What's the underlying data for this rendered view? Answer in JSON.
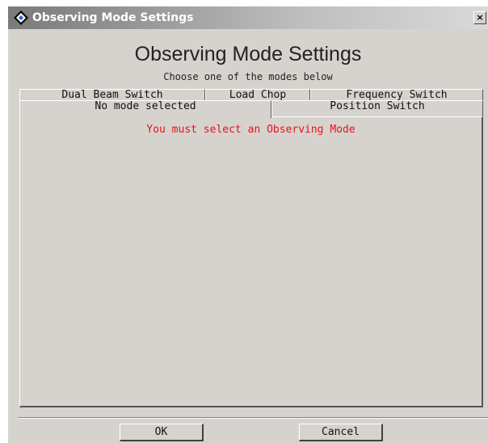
{
  "window": {
    "title": "Observing Mode Settings",
    "close_label": "×"
  },
  "header": {
    "title": "Observing Mode Settings",
    "subtitle": "Choose one of the modes below"
  },
  "tabs": [
    {
      "label": "Dual Beam Switch",
      "row": 1,
      "selected": false
    },
    {
      "label": "Load Chop",
      "row": 1,
      "selected": false
    },
    {
      "label": "Frequency Switch",
      "row": 1,
      "selected": false
    },
    {
      "label": "No mode selected",
      "row": 2,
      "selected": true
    },
    {
      "label": "Position Switch",
      "row": 2,
      "selected": false
    }
  ],
  "panel": {
    "message": "You must select an Observing Mode"
  },
  "buttons": {
    "ok_label": "OK",
    "cancel_label": "Cancel"
  },
  "colors": {
    "error_text": "#e8121b",
    "window_bg": "#d6d3ce"
  }
}
